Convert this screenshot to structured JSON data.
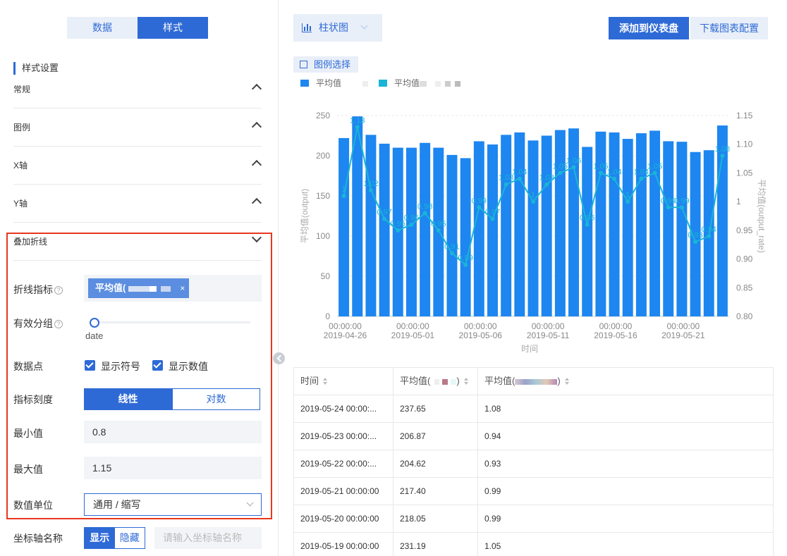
{
  "tabs": {
    "data_label": "数据",
    "style_label": "样式"
  },
  "section_title": "样式设置",
  "accordion": [
    "常规",
    "图例",
    "X轴",
    "Y轴",
    "叠加折线"
  ],
  "line_overlay": {
    "metric_label": "折线指标",
    "metric_tag": "平均值(",
    "group_label": "有效分组",
    "group_value": "date",
    "points_label": "数据点",
    "show_symbol": "显示符号",
    "show_value": "显示数值",
    "scale_label": "指标刻度",
    "scale_linear": "线性",
    "scale_log": "对数",
    "min_label": "最小值",
    "min_value": "0.8",
    "max_label": "最大值",
    "max_value": "1.15",
    "unit_label": "数值单位",
    "unit_value": "通用 / 缩写"
  },
  "axis_name": {
    "label": "坐标轴名称",
    "show": "显示",
    "hide": "隐藏",
    "placeholder": "请输入坐标轴名称"
  },
  "toolbar": {
    "chart_type": "柱状图",
    "add_dashboard": "添加到仪表盘",
    "download_config": "下载图表配置",
    "legend_select": "图例选择"
  },
  "legend": [
    {
      "name": "平均值",
      "color": "#1d86f0"
    },
    {
      "name": "平均值",
      "color": "#19b5d6"
    }
  ],
  "chart_data": {
    "type": "bar",
    "x": [
      "2019-04-25",
      "2019-04-26",
      "2019-04-27",
      "2019-04-28",
      "2019-04-29",
      "2019-04-30",
      "2019-05-01",
      "2019-05-02",
      "2019-05-03",
      "2019-05-04",
      "2019-05-05",
      "2019-05-06",
      "2019-05-07",
      "2019-05-08",
      "2019-05-09",
      "2019-05-10",
      "2019-05-11",
      "2019-05-12",
      "2019-05-13",
      "2019-05-14",
      "2019-05-15",
      "2019-05-16",
      "2019-05-17",
      "2019-05-18",
      "2019-05-19",
      "2019-05-20",
      "2019-05-21",
      "2019-05-22",
      "2019-05-23",
      "2019-05-24"
    ],
    "x_tick_labels": [
      {
        "index": 1,
        "time": "00:00:00",
        "date": "2019-04-26"
      },
      {
        "index": 6,
        "time": "00:00:00",
        "date": "2019-05-01"
      },
      {
        "index": 11,
        "time": "00:00:00",
        "date": "2019-05-06"
      },
      {
        "index": 16,
        "time": "00:00:00",
        "date": "2019-05-11"
      },
      {
        "index": 21,
        "time": "00:00:00",
        "date": "2019-05-16"
      },
      {
        "index": 26,
        "time": "00:00:00",
        "date": "2019-05-21"
      }
    ],
    "xlabel": "时间",
    "ylabel": "平均值(output)",
    "y2label": "平均值(output_rate)",
    "ylim": [
      0,
      250
    ],
    "yticks": [
      0,
      50,
      100,
      150,
      200,
      250
    ],
    "y2lim": [
      0.8,
      1.15
    ],
    "y2ticks": [
      "0.80",
      "0.85",
      "0.90",
      "0.95",
      "1",
      "1.05",
      "1.10",
      "1.15"
    ],
    "series": [
      {
        "type": "bar",
        "values": [
          222,
          249,
          226,
          215,
          210,
          210,
          216,
          210,
          201,
          197,
          218,
          214,
          226,
          229,
          219,
          225,
          232,
          234,
          211,
          230,
          229,
          221,
          228,
          231.19,
          218.05,
          217.4,
          204.62,
          206.87,
          237.65
        ]
      },
      {
        "type": "line",
        "axis": "right",
        "values": [
          1.01,
          1.13,
          1.02,
          0.97,
          0.95,
          0.96,
          0.98,
          0.95,
          0.91,
          0.89,
          0.99,
          0.97,
          1.03,
          1.04,
          1.0,
          1.03,
          1.05,
          1.06,
          0.96,
          1.05,
          1.04,
          1.0,
          1.04,
          1.05,
          0.99,
          0.99,
          0.93,
          0.94,
          1.08
        ]
      }
    ],
    "line_labels": [
      "1",
      "1.13",
      "1.02",
      "0.97",
      "0.95",
      "0.96",
      "0.98",
      "0.95",
      "0.91",
      "0.89",
      "0.99",
      "0.97",
      "1.03",
      "1.04",
      "1",
      "1.03",
      "1.05",
      "1.06",
      "0.96",
      "1.05",
      "1.04",
      "1",
      "1.04",
      "1.05",
      "0.99",
      "0.99",
      "0.93",
      "0.94",
      "1.08"
    ]
  },
  "table": {
    "headers": [
      "时间",
      "平均值(",
      "平均值("
    ],
    "rows": [
      [
        "2019-05-24 00:00:...",
        "237.65",
        "1.08"
      ],
      [
        "2019-05-23 00:00:...",
        "206.87",
        "0.94"
      ],
      [
        "2019-05-22 00:00:...",
        "204.62",
        "0.93"
      ],
      [
        "2019-05-21 00:00:00",
        "217.40",
        "0.99"
      ],
      [
        "2019-05-20 00:00:00",
        "218.05",
        "0.99"
      ],
      [
        "2019-05-19 00:00:00",
        "231.19",
        "1.05"
      ]
    ]
  }
}
